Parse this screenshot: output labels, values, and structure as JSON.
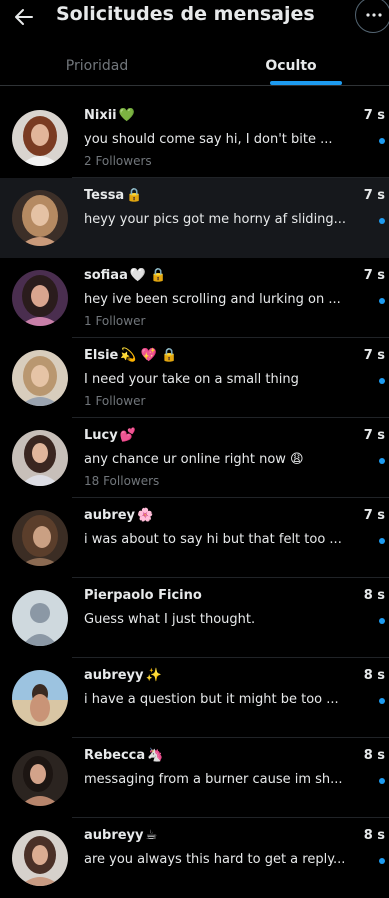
{
  "header": {
    "title": "Solicitudes de mensajes",
    "back_icon": "arrow-left-icon",
    "more_icon": "more-horizontal-icon"
  },
  "tabs": [
    {
      "label": "Prioridad",
      "active": false
    },
    {
      "label": "Oculto",
      "active": true
    }
  ],
  "colors": {
    "accent": "#1d9bf0",
    "background": "#000000",
    "muted": "#71767b",
    "text": "#e7e9ea"
  },
  "conversations": [
    {
      "name": "Nixii",
      "badge": "💚",
      "time": "7 s",
      "message": "you should come say hi, I don't bite ...",
      "followers": "2 Followers",
      "unread": true
    },
    {
      "name": "Tessa",
      "badge": "🔒",
      "time": "7 s",
      "message": "heyy your pics got me horny af sliding...",
      "followers": "",
      "unread": true
    },
    {
      "name": "sofiaa",
      "badge": "🤍 🔒",
      "time": "7 s",
      "message": "hey ive been scrolling and lurking on ...",
      "followers": "1 Follower",
      "unread": true
    },
    {
      "name": "Elsie",
      "badge": "💫 💖 🔒",
      "time": "7 s",
      "message": "I need your take on a small thing",
      "followers": "1 Follower",
      "unread": true
    },
    {
      "name": "Lucy",
      "badge": "💕",
      "time": "7 s",
      "message": "any chance ur online right now 😩",
      "followers": "18 Followers",
      "unread": true
    },
    {
      "name": "aubrey",
      "badge": "🌸",
      "time": "7 s",
      "message": "i was about to say hi but that felt too ...",
      "followers": "",
      "unread": true
    },
    {
      "name": "Pierpaolo Ficino",
      "badge": "",
      "time": "8 s",
      "message": "Guess what I just thought.",
      "followers": "",
      "unread": true
    },
    {
      "name": "aubreyy",
      "badge": "✨",
      "time": "8 s",
      "message": "i have a question but it might be too ...",
      "followers": "",
      "unread": true
    },
    {
      "name": "Rebecca",
      "badge": "🦄",
      "time": "8 s",
      "message": "messaging from a burner cause im sh...",
      "followers": "",
      "unread": true
    },
    {
      "name": "aubreyy",
      "badge": "☕",
      "time": "8 s",
      "message": "are you always this hard to get a reply...",
      "followers": "",
      "unread": true
    }
  ]
}
